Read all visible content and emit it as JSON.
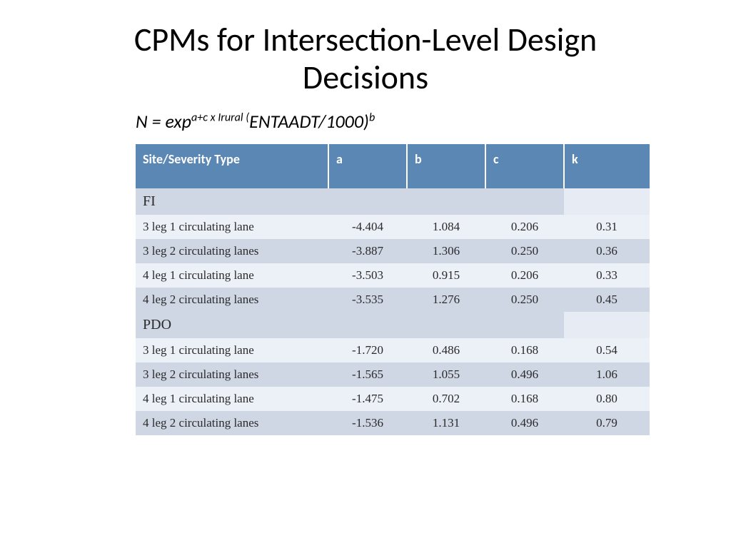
{
  "title": "CPMs for Intersection-Level Design Decisions",
  "formula": {
    "prefix": "N = exp",
    "sup1": "a+c x Irural (",
    "mid": "ENTAADT/1000)",
    "sup2": "b"
  },
  "headers": {
    "site": "Site/Severity Type",
    "a": "a",
    "b": "b",
    "c": "c",
    "k": "k"
  },
  "section_fi": "FI",
  "section_pdo": "PDO",
  "rows_fi": [
    {
      "site": "3 leg 1 circulating lane",
      "a": "-4.404",
      "b": "1.084",
      "c": "0.206",
      "k": "0.31"
    },
    {
      "site": "3 leg 2 circulating lanes",
      "a": "-3.887",
      "b": "1.306",
      "c": "0.250",
      "k": "0.36"
    },
    {
      "site": "4 leg 1 circulating lane",
      "a": "-3.503",
      "b": "0.915",
      "c": "0.206",
      "k": "0.33"
    },
    {
      "site": "4 leg 2 circulating lanes",
      "a": "-3.535",
      "b": "1.276",
      "c": "0.250",
      "k": "0.45"
    }
  ],
  "rows_pdo": [
    {
      "site": "3 leg 1 circulating lane",
      "a": "-1.720",
      "b": "0.486",
      "c": "0.168",
      "k": "0.54"
    },
    {
      "site": "3 leg 2 circulating lanes",
      "a": "-1.565",
      "b": "1.055",
      "c": "0.496",
      "k": "1.06"
    },
    {
      "site": "4 leg 1 circulating lane",
      "a": "-1.475",
      "b": "0.702",
      "c": "0.168",
      "k": "0.80"
    },
    {
      "site": "4 leg 2 circulating lanes",
      "a": "-1.536",
      "b": "1.131",
      "c": "0.496",
      "k": "0.79"
    }
  ]
}
